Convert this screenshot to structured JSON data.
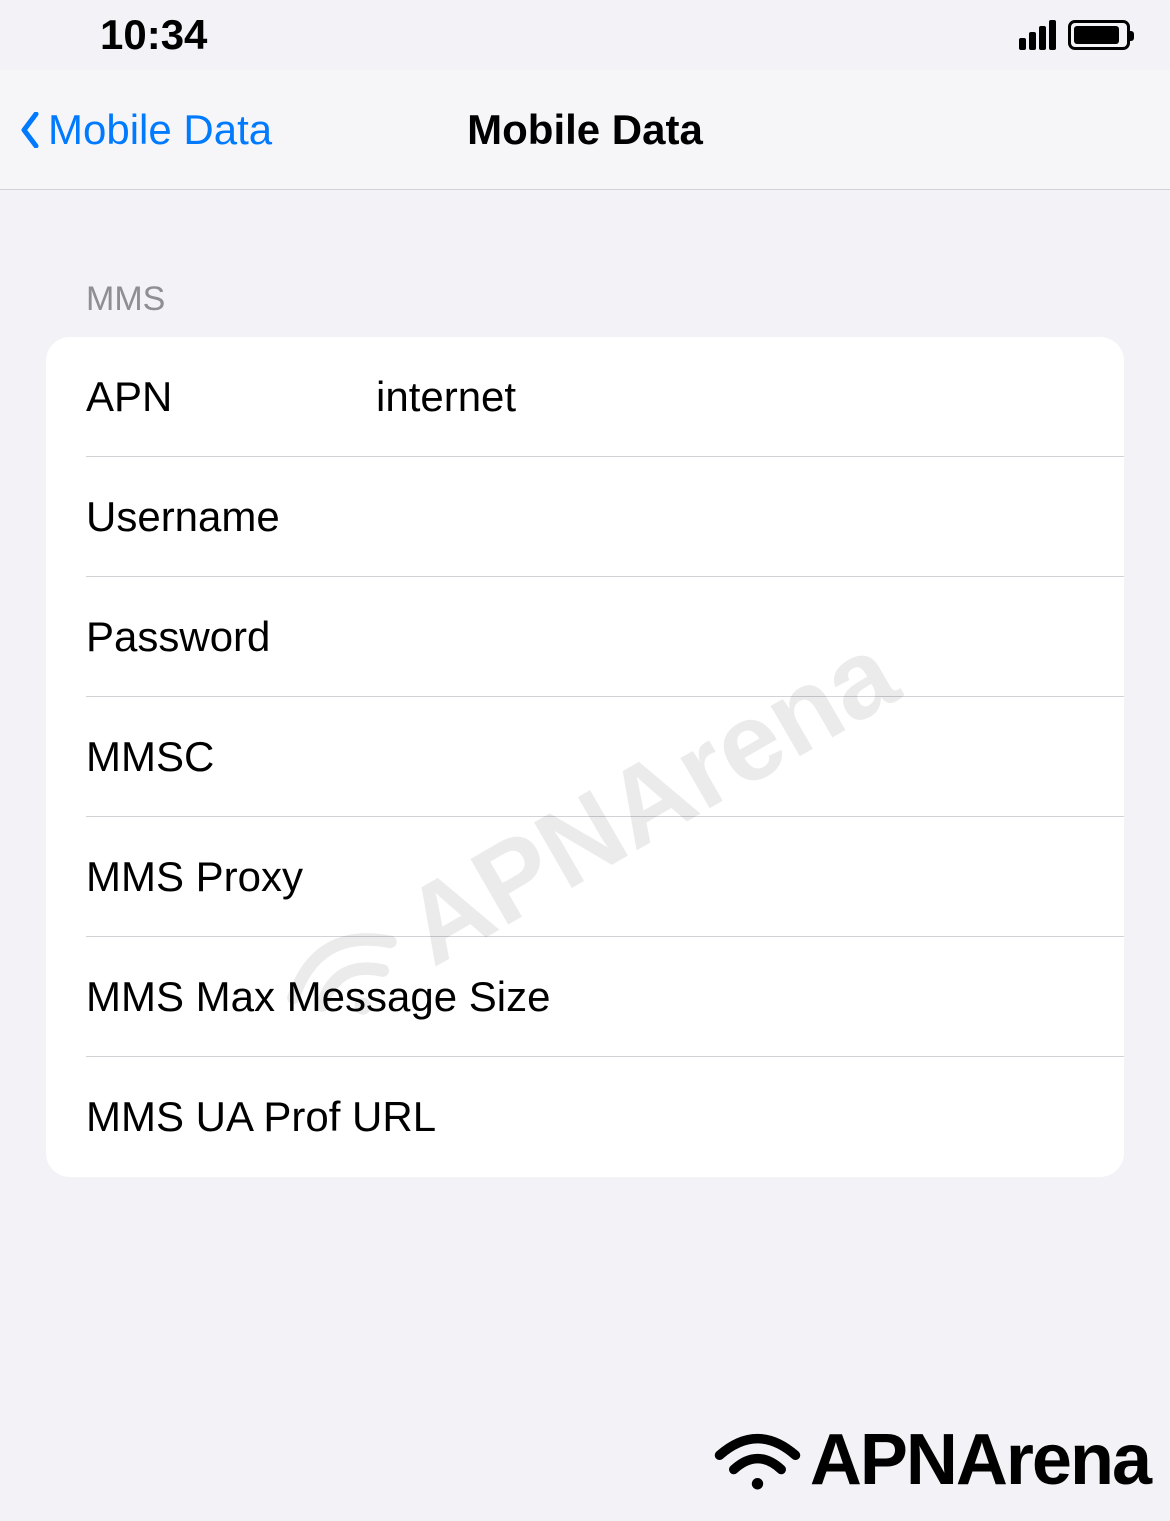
{
  "status": {
    "time": "10:34"
  },
  "nav": {
    "back_label": "Mobile Data",
    "title": "Mobile Data"
  },
  "section": {
    "header": "MMS"
  },
  "fields": {
    "apn": {
      "label": "APN",
      "value": "internet"
    },
    "username": {
      "label": "Username",
      "value": ""
    },
    "password": {
      "label": "Password",
      "value": ""
    },
    "mmsc": {
      "label": "MMSC",
      "value": ""
    },
    "mms_proxy": {
      "label": "MMS Proxy",
      "value": ""
    },
    "mms_max_size": {
      "label": "MMS Max Message Size",
      "value": ""
    },
    "mms_ua_prof": {
      "label": "MMS UA Prof URL",
      "value": ""
    }
  },
  "watermark": "APNArena",
  "brand": "APNArena"
}
